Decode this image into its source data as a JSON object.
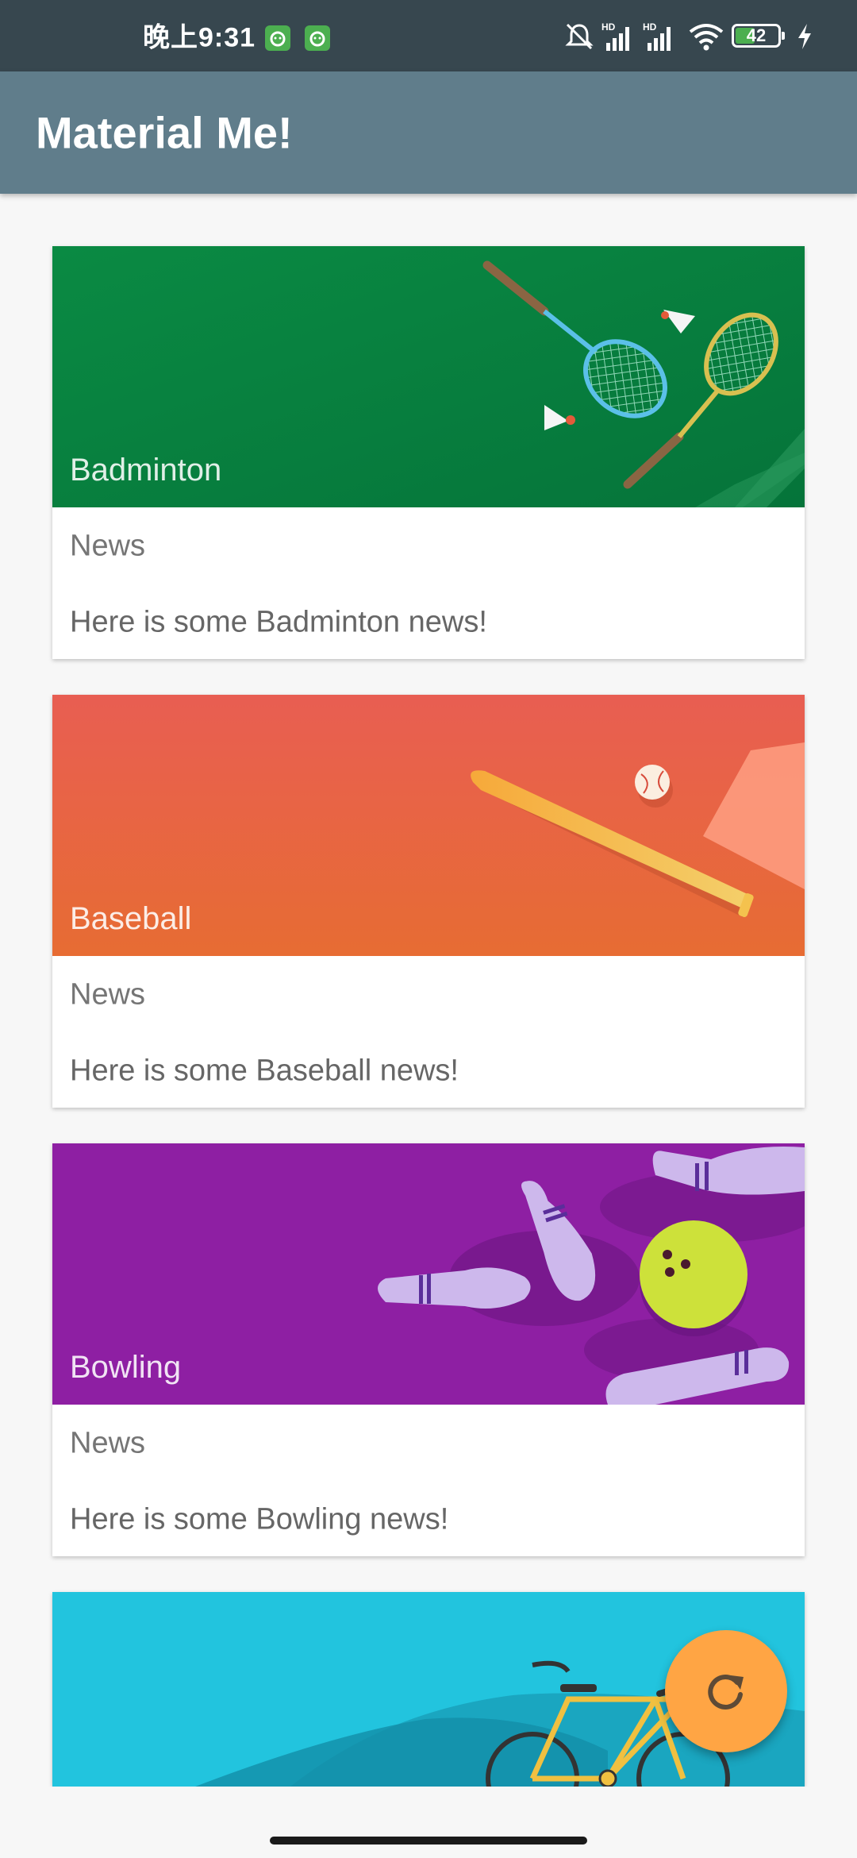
{
  "status_bar": {
    "time": "晚上9:31",
    "battery": "42",
    "icons": [
      "app-badge-icon",
      "app-badge-icon",
      "mute-icon",
      "signal-hd-icon",
      "signal-hd-icon",
      "wifi-icon",
      "battery-icon",
      "charging-icon"
    ]
  },
  "app_bar": {
    "title": "Material Me!"
  },
  "cards": [
    {
      "title": "Badminton",
      "subtitle": "News",
      "info": "Here is some Badminton news!",
      "color": "#06803c"
    },
    {
      "title": "Baseball",
      "subtitle": "News",
      "info": "Here is some Baseball news!",
      "color": "#e9674a"
    },
    {
      "title": "Bowling",
      "subtitle": "News",
      "info": "Here is some Bowling news!",
      "color": "#8e1fa3"
    },
    {
      "title": "",
      "subtitle": "",
      "info": "",
      "color": "#22c4de"
    }
  ],
  "fab": {
    "icon": "refresh-icon",
    "color": "#ffa544"
  },
  "colors": {
    "status_bar": "#37474f",
    "app_bar": "#607d8b",
    "background": "#f7f7f7"
  }
}
